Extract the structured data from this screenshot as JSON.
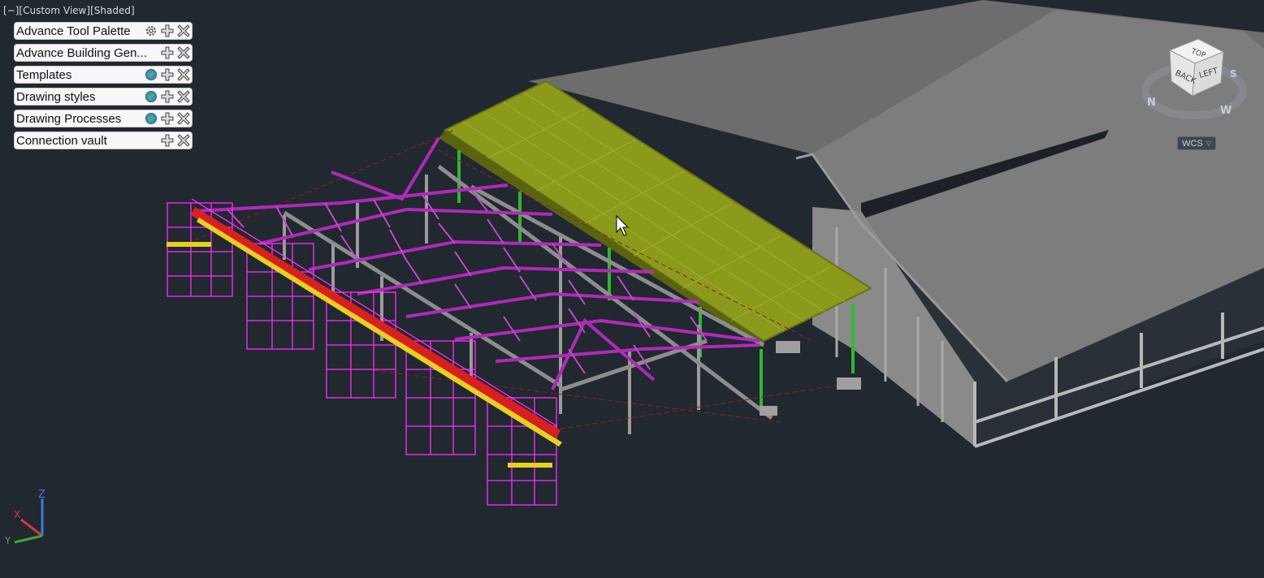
{
  "viewport": {
    "controls": "[−]",
    "view": "[Custom View]",
    "style": "[Shaded]"
  },
  "palettes": [
    {
      "label": "Advance Tool Palette",
      "icon": "gear-icon"
    },
    {
      "label": "Advance Building Gen...",
      "icon": null
    },
    {
      "label": "Templates",
      "icon": "globe-icon"
    },
    {
      "label": "Drawing styles",
      "icon": "globe-icon"
    },
    {
      "label": "Drawing Processes",
      "icon": "globe-icon"
    },
    {
      "label": "Connection vault",
      "icon": null
    }
  ],
  "viewcube": {
    "face_top": "TOP",
    "face_back": "BACK",
    "face_left": "LEFT",
    "compass_n": "N",
    "compass_s": "S",
    "compass_w": "W"
  },
  "wcs": {
    "label": "WCS"
  },
  "ucs": {
    "x": "X",
    "y": "Y",
    "z": "Z"
  },
  "colors": {
    "background": "#212830",
    "roof": "#8c9a1c",
    "truss": "#b02ab8",
    "scaffold": "#ff2dff",
    "column": "#2fb82f",
    "building": "#7c7c7c"
  }
}
